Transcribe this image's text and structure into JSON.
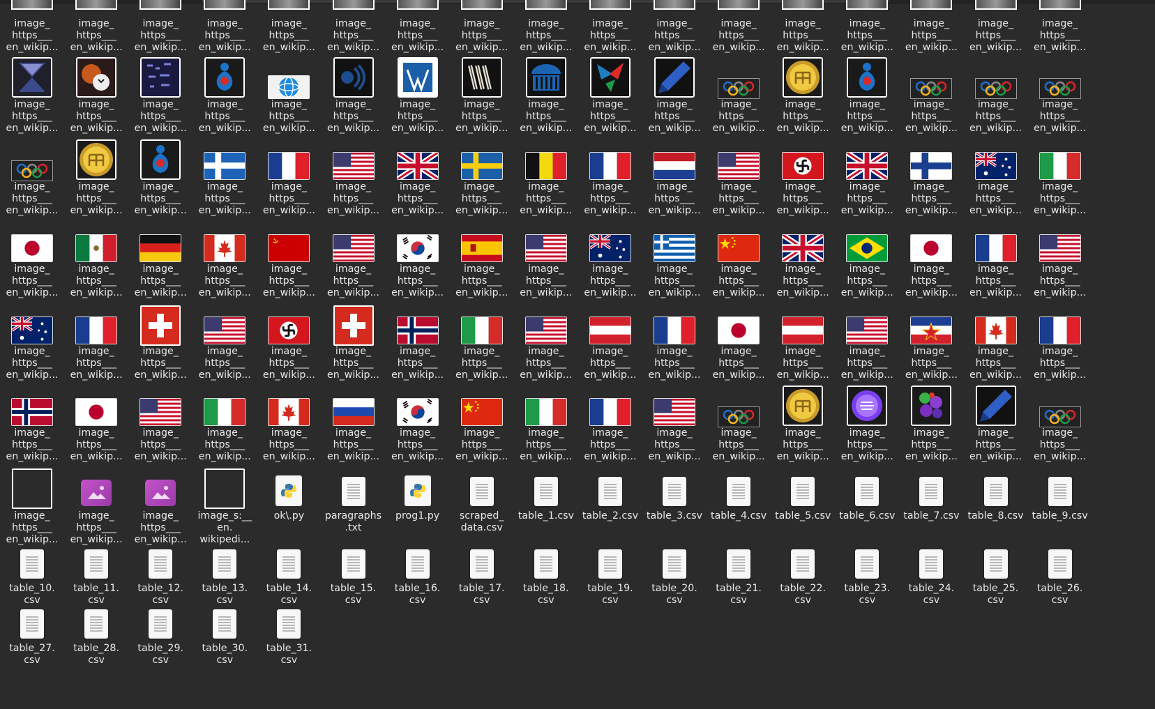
{
  "window": {
    "title": ""
  },
  "files": [
    {
      "label": "image_\nhttps___\nen_wikip...",
      "icon": "crop-icon"
    },
    {
      "label": "image_\nhttps___\nen_wikip...",
      "icon": "crop-icon"
    },
    {
      "label": "image_\nhttps___\nen_wikip...",
      "icon": "crop-icon"
    },
    {
      "label": "image_\nhttps___\nen_wikip...",
      "icon": "crop-icon"
    },
    {
      "label": "image_\nhttps___\nen_wikip...",
      "icon": "crop-icon"
    },
    {
      "label": "image_\nhttps___\nen_wikip...",
      "icon": "crop-icon"
    },
    {
      "label": "image_\nhttps___\nen_wikip...",
      "icon": "crop-icon"
    },
    {
      "label": "image_\nhttps___\nen_wikip...",
      "icon": "crop-icon"
    },
    {
      "label": "image_\nhttps___\nen_wikip...",
      "icon": "crop-icon"
    },
    {
      "label": "image_\nhttps___\nen_wikip...",
      "icon": "crop-icon"
    },
    {
      "label": "image_\nhttps___\nen_wikip...",
      "icon": "crop-icon"
    },
    {
      "label": "image_\nhttps___\nen_wikip...",
      "icon": "crop-icon"
    },
    {
      "label": "image_\nhttps___\nen_wikip...",
      "icon": "crop-icon"
    },
    {
      "label": "image_\nhttps___\nen_wikip...",
      "icon": "crop-icon"
    },
    {
      "label": "image_\nhttps___\nen_wikip...",
      "icon": "crop-icon"
    },
    {
      "label": "image_\nhttps___\nen_wikip...",
      "icon": "crop-icon"
    },
    {
      "label": "image_\nhttps___\nen_wikip...",
      "icon": "crop-icon"
    },
    {
      "label": "image_\nhttps___\nen_wikip...",
      "icon": "hourglass-icon"
    },
    {
      "label": "image_\nhttps___\nen_wikip...",
      "icon": "sports-balls-icon"
    },
    {
      "label": "image_\nhttps___\nen_wikip...",
      "icon": "dark-pattern-icon"
    },
    {
      "label": "image_\nhttps___\nen_wikip...",
      "icon": "blue-figure-icon"
    },
    {
      "label": "image_\nhttps___\nen_wikip...",
      "icon": "globe-icon"
    },
    {
      "label": "image_\nhttps___\nen_wikip...",
      "icon": "wikinews-icon"
    },
    {
      "label": "image_\nhttps___\nen_wikip...",
      "icon": "wikibooks-icon"
    },
    {
      "label": "image_\nhttps___\nen_wikip...",
      "icon": "wikisource-icon"
    },
    {
      "label": "image_\nhttps___\nen_wikip...",
      "icon": "building-icon"
    },
    {
      "label": "image_\nhttps___\nen_wikip...",
      "icon": "wikiversity-icon"
    },
    {
      "label": "image_\nhttps___\nen_wikip...",
      "icon": "pencil-icon"
    },
    {
      "label": "image_\nhttps___\nen_wikip...",
      "icon": "olympic-rings-icon"
    },
    {
      "label": "image_\nhttps___\nen_wikip...",
      "icon": "gold-coin-icon"
    },
    {
      "label": "image_\nhttps___\nen_wikip...",
      "icon": "blue-figure-icon"
    },
    {
      "label": "image_\nhttps___\nen_wikip...",
      "icon": "olympic-rings-icon"
    },
    {
      "label": "image_\nhttps___\nen_wikip...",
      "icon": "olympic-rings-icon"
    },
    {
      "label": "image_\nhttps___\nen_wikip...",
      "icon": "olympic-rings-icon"
    },
    {
      "label": "image_\nhttps___\nen_wikip...",
      "icon": "olympic-rings-icon"
    },
    {
      "label": "image_\nhttps___\nen_wikip...",
      "icon": "gold-coin-icon"
    },
    {
      "label": "image_\nhttps___\nen_wikip...",
      "icon": "blue-figure-icon"
    },
    {
      "label": "image_\nhttps___\nen_wikip...",
      "icon": "flag-greece-old-icon"
    },
    {
      "label": "image_\nhttps___\nen_wikip...",
      "icon": "flag-france-icon"
    },
    {
      "label": "image_\nhttps___\nen_wikip...",
      "icon": "flag-usa-icon"
    },
    {
      "label": "image_\nhttps___\nen_wikip...",
      "icon": "flag-uk-icon"
    },
    {
      "label": "image_\nhttps___\nen_wikip...",
      "icon": "flag-sweden-icon"
    },
    {
      "label": "image_\nhttps___\nen_wikip...",
      "icon": "flag-belgium-icon"
    },
    {
      "label": "image_\nhttps___\nen_wikip...",
      "icon": "flag-france-icon"
    },
    {
      "label": "image_\nhttps___\nen_wikip...",
      "icon": "flag-netherlands-icon"
    },
    {
      "label": "image_\nhttps___\nen_wikip...",
      "icon": "flag-usa-icon"
    },
    {
      "label": "image_\nhttps___\nen_wikip...",
      "icon": "flag-swastika-icon"
    },
    {
      "label": "image_\nhttps___\nen_wikip...",
      "icon": "flag-uk-icon"
    },
    {
      "label": "image_\nhttps___\nen_wikip...",
      "icon": "flag-finland-icon"
    },
    {
      "label": "image_\nhttps___\nen_wikip...",
      "icon": "flag-australia-icon"
    },
    {
      "label": "image_\nhttps___\nen_wikip...",
      "icon": "flag-italy-icon"
    },
    {
      "label": "image_\nhttps___\nen_wikip...",
      "icon": "flag-japan-icon"
    },
    {
      "label": "image_\nhttps___\nen_wikip...",
      "icon": "flag-mexico-icon"
    },
    {
      "label": "image_\nhttps___\nen_wikip...",
      "icon": "flag-germany-icon"
    },
    {
      "label": "image_\nhttps___\nen_wikip...",
      "icon": "flag-canada-icon"
    },
    {
      "label": "image_\nhttps___\nen_wikip...",
      "icon": "flag-ussr-icon"
    },
    {
      "label": "image_\nhttps___\nen_wikip...",
      "icon": "flag-usa-icon"
    },
    {
      "label": "image_\nhttps___\nen_wikip...",
      "icon": "flag-korea-icon"
    },
    {
      "label": "image_\nhttps___\nen_wikip...",
      "icon": "flag-spain-icon"
    },
    {
      "label": "image_\nhttps___\nen_wikip...",
      "icon": "flag-usa-icon"
    },
    {
      "label": "image_\nhttps___\nen_wikip...",
      "icon": "flag-australia-icon"
    },
    {
      "label": "image_\nhttps___\nen_wikip...",
      "icon": "flag-greece-icon"
    },
    {
      "label": "image_\nhttps___\nen_wikip...",
      "icon": "flag-china-icon"
    },
    {
      "label": "image_\nhttps___\nen_wikip...",
      "icon": "flag-uk-icon"
    },
    {
      "label": "image_\nhttps___\nen_wikip...",
      "icon": "flag-brazil-icon"
    },
    {
      "label": "image_\nhttps___\nen_wikip...",
      "icon": "flag-japan-icon"
    },
    {
      "label": "image_\nhttps___\nen_wikip...",
      "icon": "flag-france-icon"
    },
    {
      "label": "image_\nhttps___\nen_wikip...",
      "icon": "flag-usa-icon"
    },
    {
      "label": "image_\nhttps___\nen_wikip...",
      "icon": "flag-australia-icon"
    },
    {
      "label": "image_\nhttps___\nen_wikip...",
      "icon": "flag-france-icon"
    },
    {
      "label": "image_\nhttps___\nen_wikip...",
      "icon": "flag-switzerland-icon"
    },
    {
      "label": "image_\nhttps___\nen_wikip...",
      "icon": "flag-usa-icon"
    },
    {
      "label": "image_\nhttps___\nen_wikip...",
      "icon": "flag-swastika-icon"
    },
    {
      "label": "image_\nhttps___\nen_wikip...",
      "icon": "flag-switzerland-icon"
    },
    {
      "label": "image_\nhttps___\nen_wikip...",
      "icon": "flag-norway-icon"
    },
    {
      "label": "image_\nhttps___\nen_wikip...",
      "icon": "flag-italy-icon"
    },
    {
      "label": "image_\nhttps___\nen_wikip...",
      "icon": "flag-usa-icon"
    },
    {
      "label": "image_\nhttps___\nen_wikip...",
      "icon": "flag-austria-icon"
    },
    {
      "label": "image_\nhttps___\nen_wikip...",
      "icon": "flag-france-icon"
    },
    {
      "label": "image_\nhttps___\nen_wikip...",
      "icon": "flag-japan-icon"
    },
    {
      "label": "image_\nhttps___\nen_wikip...",
      "icon": "flag-austria-icon"
    },
    {
      "label": "image_\nhttps___\nen_wikip...",
      "icon": "flag-usa-icon"
    },
    {
      "label": "image_\nhttps___\nen_wikip...",
      "icon": "flag-yugoslavia-icon"
    },
    {
      "label": "image_\nhttps___\nen_wikip...",
      "icon": "flag-canada-icon"
    },
    {
      "label": "image_\nhttps___\nen_wikip...",
      "icon": "flag-france-icon"
    },
    {
      "label": "image_\nhttps___\nen_wikip...",
      "icon": "flag-norway-icon"
    },
    {
      "label": "image_\nhttps___\nen_wikip...",
      "icon": "flag-japan-icon"
    },
    {
      "label": "image_\nhttps___\nen_wikip...",
      "icon": "flag-usa-icon"
    },
    {
      "label": "image_\nhttps___\nen_wikip...",
      "icon": "flag-italy-icon"
    },
    {
      "label": "image_\nhttps___\nen_wikip...",
      "icon": "flag-canada-icon"
    },
    {
      "label": "image_\nhttps___\nen_wikip...",
      "icon": "flag-russia-icon"
    },
    {
      "label": "image_\nhttps___\nen_wikip...",
      "icon": "flag-korea-icon"
    },
    {
      "label": "image_\nhttps___\nen_wikip...",
      "icon": "flag-china-icon"
    },
    {
      "label": "image_\nhttps___\nen_wikip...",
      "icon": "flag-italy-icon"
    },
    {
      "label": "image_\nhttps___\nen_wikip...",
      "icon": "flag-france-icon"
    },
    {
      "label": "image_\nhttps___\nen_wikip...",
      "icon": "flag-usa-icon"
    },
    {
      "label": "image_\nhttps___\nen_wikip...",
      "icon": "olympic-rings-icon"
    },
    {
      "label": "image_\nhttps___\nen_wikip...",
      "icon": "gold-coin-icon"
    },
    {
      "label": "image_\nhttps___\nen_wikip...",
      "icon": "purple-circle-icon"
    },
    {
      "label": "image_\nhttps___\nen_wikip...",
      "icon": "puzzle-icon"
    },
    {
      "label": "image_\nhttps___\nen_wikip...",
      "icon": "pencil-icon"
    },
    {
      "label": "image_\nhttps___\nen_wikip...",
      "icon": "olympic-rings-icon"
    },
    {
      "label": "image_\nhttps___\nen_wikip...",
      "icon": "blank-image-icon"
    },
    {
      "label": "image_\nhttps___\nen_wikip...",
      "icon": "image-file-icon"
    },
    {
      "label": "image_\nhttps___\nen_wikip...",
      "icon": "image-file-icon"
    },
    {
      "label": "image_s:__\nen.\nwikipedi...",
      "icon": "blank-image-icon"
    },
    {
      "label": "ok\\.py",
      "icon": "python-file-icon"
    },
    {
      "label": "paragraphs\n.txt",
      "icon": "text-file-icon"
    },
    {
      "label": "prog1.py",
      "icon": "python-file-icon"
    },
    {
      "label": "scraped_\ndata.csv",
      "icon": "text-file-icon"
    },
    {
      "label": "table_1.csv",
      "icon": "text-file-icon"
    },
    {
      "label": "table_2.csv",
      "icon": "text-file-icon"
    },
    {
      "label": "table_3.csv",
      "icon": "text-file-icon"
    },
    {
      "label": "table_4.csv",
      "icon": "text-file-icon"
    },
    {
      "label": "table_5.csv",
      "icon": "text-file-icon"
    },
    {
      "label": "table_6.csv",
      "icon": "text-file-icon"
    },
    {
      "label": "table_7.csv",
      "icon": "text-file-icon"
    },
    {
      "label": "table_8.csv",
      "icon": "text-file-icon"
    },
    {
      "label": "table_9.csv",
      "icon": "text-file-icon"
    },
    {
      "label": "table_10.\ncsv",
      "icon": "text-file-icon"
    },
    {
      "label": "table_11.\ncsv",
      "icon": "text-file-icon"
    },
    {
      "label": "table_12.\ncsv",
      "icon": "text-file-icon"
    },
    {
      "label": "table_13.\ncsv",
      "icon": "text-file-icon"
    },
    {
      "label": "table_14.\ncsv",
      "icon": "text-file-icon"
    },
    {
      "label": "table_15.\ncsv",
      "icon": "text-file-icon"
    },
    {
      "label": "table_16.\ncsv",
      "icon": "text-file-icon"
    },
    {
      "label": "table_17.\ncsv",
      "icon": "text-file-icon"
    },
    {
      "label": "table_18.\ncsv",
      "icon": "text-file-icon"
    },
    {
      "label": "table_19.\ncsv",
      "icon": "text-file-icon"
    },
    {
      "label": "table_20.\ncsv",
      "icon": "text-file-icon"
    },
    {
      "label": "table_21.\ncsv",
      "icon": "text-file-icon"
    },
    {
      "label": "table_22.\ncsv",
      "icon": "text-file-icon"
    },
    {
      "label": "table_23.\ncsv",
      "icon": "text-file-icon"
    },
    {
      "label": "table_24.\ncsv",
      "icon": "text-file-icon"
    },
    {
      "label": "table_25.\ncsv",
      "icon": "text-file-icon"
    },
    {
      "label": "table_26.\ncsv",
      "icon": "text-file-icon"
    },
    {
      "label": "table_27.\ncsv",
      "icon": "text-file-icon"
    },
    {
      "label": "table_28.\ncsv",
      "icon": "text-file-icon"
    },
    {
      "label": "table_29.\ncsv",
      "icon": "text-file-icon"
    },
    {
      "label": "table_30.\ncsv",
      "icon": "text-file-icon"
    },
    {
      "label": "table_31.\ncsv",
      "icon": "text-file-icon"
    }
  ],
  "colors": {
    "background": "#2b2b2b",
    "label": "#e8e8e8"
  }
}
